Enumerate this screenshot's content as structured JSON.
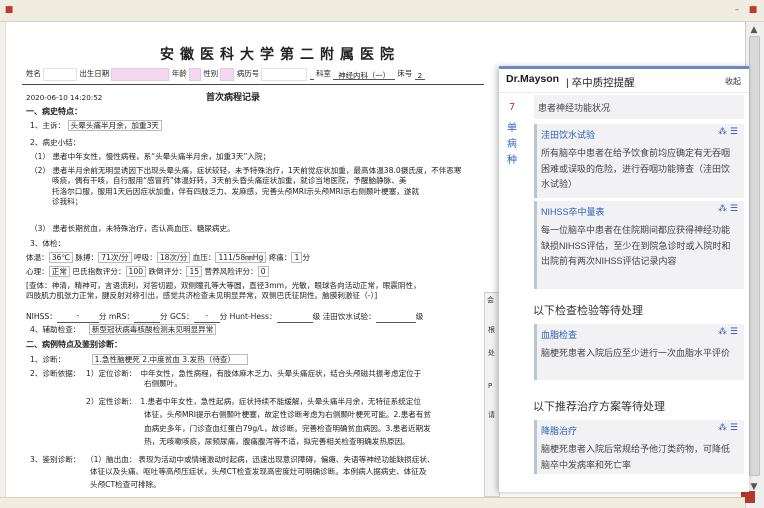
{
  "window": {
    "right_icons": [
      "minimize-icon",
      "maximize-icon",
      "close-icon"
    ]
  },
  "document": {
    "hospital": "安徽医科大学第二附属医院",
    "fields": {
      "name_label": "姓名",
      "dob_label": "出生日期",
      "age_label": "年龄",
      "gender_label": "性别",
      "record_no_label": "病历号",
      "dept_label": "科室",
      "dept_value": "神经内科（一）",
      "bed_label": "床号",
      "bed_value": "2"
    },
    "datetime": "2020-06-10 14:20:52",
    "record_title": "首次病程记录",
    "s1": "一、病史特点：",
    "chief_label": "1、主诉：",
    "chief_value": "头晕头痛半月余，加重3天",
    "history_label": "2、病史小结：",
    "h1_num": "（1）",
    "h1": "患者中年女性，慢性病程，系“头晕头痛半月余，加重3天”入院；",
    "h2_num": "（2）",
    "h2a": "患者半月余前无明显诱因下出现头晕头痛，症状较轻，未予特殊治疗，1天前觉症状加重，最高体温38.0摄氏度，不伴恶寒",
    "h2b": "咳痰，偶有干咳，自行服用“感冒药”体温好转，3天前头昏头痛症状加重，就诊当地医院，予醒脑静脉、美",
    "h2c": "托洛尔口服，服用1天后因症状加重，伴有四肢乏力、发麻感，完善头颅MRI示头颅MRI示右侧颞叶梗塞，遂就",
    "h2d": "诊我科；",
    "h3_num": "（3）",
    "h3": "患者长期贫血，未特殊治疗，否认高血压、糖尿病史。",
    "exam_label": "3、体检：",
    "vitals": {
      "temp_label": "体温：",
      "temp": "36℃",
      "pulse_label": "脉搏：",
      "pulse": "71次/分",
      "resp_label": "呼吸：",
      "resp": "18次/分",
      "bp_label": "血压：",
      "bp": "111/58㎜Hg",
      "pain_label": "疼痛：",
      "pain": "1",
      "pain_unit": "分"
    },
    "scores": {
      "heart_label": "心理：",
      "heart": "正常",
      "barthel_label": "巴氏指数评分：",
      "barthel": "100",
      "braden_label": "跌倒评分：",
      "braden": "15",
      "nutrition_label": "营养风险评分：",
      "nutrition": "0"
    },
    "neuro1": "[查体：神清，精神可，言语流利，对答切题，双侧瞳孔等大等圆，直径3mm，光敏，眼球各向活动正常，眼震阴性，",
    "neuro2": "四肢肌力肌张力正常，腱反射对称引出，感觉共济检查未见明显异常，双侧巴氏征阴性。脑膜刺激征（-）]",
    "scales": {
      "nihss_label": "NIHSS：",
      "nihss": "-",
      "nihss_unit": "分",
      "mrs_label": "mRS：",
      "mrs": "",
      "mrs_unit": "分",
      "gcs_label": "GCS：",
      "gcs": "-",
      "gcs_unit": "分",
      "hunt_label": "Hunt-Hess：",
      "hunt": "",
      "hunt_unit": "级",
      "water_label": "洼田饮水试验：",
      "water": "",
      "water_unit": "级"
    },
    "aux_label": "4、辅助检查：",
    "aux_value": "新型冠状病毒核酸检测未见明显异常",
    "s2": "二、病例特点及鉴别诊断：",
    "dx_label": "1、诊断：",
    "dx_value": "1.急性脑梗死 2.中度贫血 3.发热（待查）",
    "basis_label": "2、诊断依据：",
    "basis1_label": "1）定位诊断：",
    "basis1a": "中年女性，急性病程，有肢体麻木乏力、头晕头痛症状，结合头颅磁共振考虑定位于",
    "basis1b": "右侧颞叶。",
    "basis2_label": "2）定性诊断：",
    "basis2a": "1.患者中年女性，急性起病，症状持续不能缓解，头晕头痛半月余，无特征系统定位",
    "basis2b": "体征，头颅MRI提示右侧颞叶梗塞，故定性诊断考虑为右侧颞叶梗死可能。2.患者有贫",
    "basis2c": "血病史多年，门诊查血红蛋白79g/L，故诊断。完善检查明确贫血病因。3.患者近期发",
    "basis2d": "热，无咳嗽咳痰，尿频尿痛，腹痛腹泻等不适，拟完善相关检查明确发热原因。",
    "diff_label": "3、鉴别诊断：",
    "diff1_label": "（1）脑出血：",
    "diff1a": "表现为活动中或情绪激动时起病，迅速出现意识障碍，偏瘫、失语等神经功能缺损症状、",
    "diff1b": "体征以及头痛、呕吐等高颅压症状，头颅CT检查发现高密度灶可明确诊断。本例病人据病史、体征及",
    "diff1c": "头颅CT检查可排除。"
  },
  "panel": {
    "brand": "Dr.Mayson",
    "title": "| 卒中质控提醒",
    "collapse": "收起",
    "side_num": "7",
    "side_chars": [
      "单",
      "病",
      "种"
    ],
    "intro": "患者神经功能状况",
    "cards": [
      {
        "title": "洼田饮水试验",
        "body": "所有脑卒中患者在给予饮食前均应确定有无吞咽困难或误吸的危险，进行吞咽功能筛查（洼田饮水试验）"
      },
      {
        "title": "NIHSS卒中量表",
        "body": "每一位脑卒中患者在住院期间都应获得神经功能缺损NIHSS评估，至少在到院急诊时或入院时和出院前有两次NIHSS评估记录内容"
      }
    ],
    "section2": "以下检查检验等待处理",
    "cards2": [
      {
        "title": "血脂检查",
        "body": "脑梗死患者入院后应至少进行一次血脂水平评价"
      }
    ],
    "section3": "以下推荐治疗方案等待处理",
    "cards3": [
      {
        "title": "降脂治疗",
        "body": "脑梗死患者入院后常规给予他汀类药物，可降低脑卒中发病率和死亡率"
      }
    ]
  },
  "dialog_fragment": {
    "labels": [
      "会",
      "根",
      "处",
      "P",
      "请"
    ]
  },
  "colors": {
    "accent_blue": "#2a5fb8",
    "panel_top": "#6a88c8",
    "pink_mask": "#f3d9ee",
    "card_bg": "#f2f2f4"
  }
}
